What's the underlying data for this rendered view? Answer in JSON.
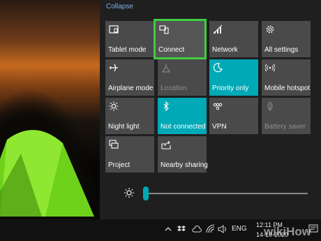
{
  "action_center": {
    "collapse_label": "Collapse",
    "tiles": [
      {
        "label": "Tablet mode",
        "icon": "tablet-mode-icon",
        "state": "off"
      },
      {
        "label": "Connect",
        "icon": "connect-icon",
        "state": "off",
        "highlighted": true
      },
      {
        "label": "Network",
        "icon": "network-icon",
        "state": "off"
      },
      {
        "label": "All settings",
        "icon": "gear-icon",
        "state": "off"
      },
      {
        "label": "Airplane mode",
        "icon": "airplane-icon",
        "state": "off"
      },
      {
        "label": "Location",
        "icon": "location-icon",
        "state": "disabled"
      },
      {
        "label": "Priority only",
        "icon": "moon-icon",
        "state": "on"
      },
      {
        "label": "Mobile hotspot",
        "icon": "hotspot-icon",
        "state": "off"
      },
      {
        "label": "Night light",
        "icon": "sun-icon",
        "state": "off"
      },
      {
        "label": "Not connected",
        "icon": "bluetooth-icon",
        "state": "on"
      },
      {
        "label": "VPN",
        "icon": "vpn-icon",
        "state": "off"
      },
      {
        "label": "Battery saver",
        "icon": "battery-saver-icon",
        "state": "disabled"
      },
      {
        "label": "Project",
        "icon": "project-icon",
        "state": "off"
      },
      {
        "label": "Nearby sharing",
        "icon": "nearby-sharing-icon",
        "state": "off"
      }
    ],
    "brightness": {
      "icon": "brightness-icon",
      "level": 0
    }
  },
  "taskbar": {
    "language": "ENG",
    "time": "12:11 PM",
    "date": "14-10-2020",
    "tray_icons": [
      "chevron-up-icon",
      "dropbox-icon",
      "cloud-icon",
      "wifi-icon",
      "volume-icon"
    ]
  },
  "watermark": "wikiHow",
  "colors": {
    "accent": "#00a9b6",
    "tile": "#4a4a4a",
    "panel": "#1f1f1f",
    "highlight": "#3ecf3e",
    "link": "#7fb3e6"
  }
}
